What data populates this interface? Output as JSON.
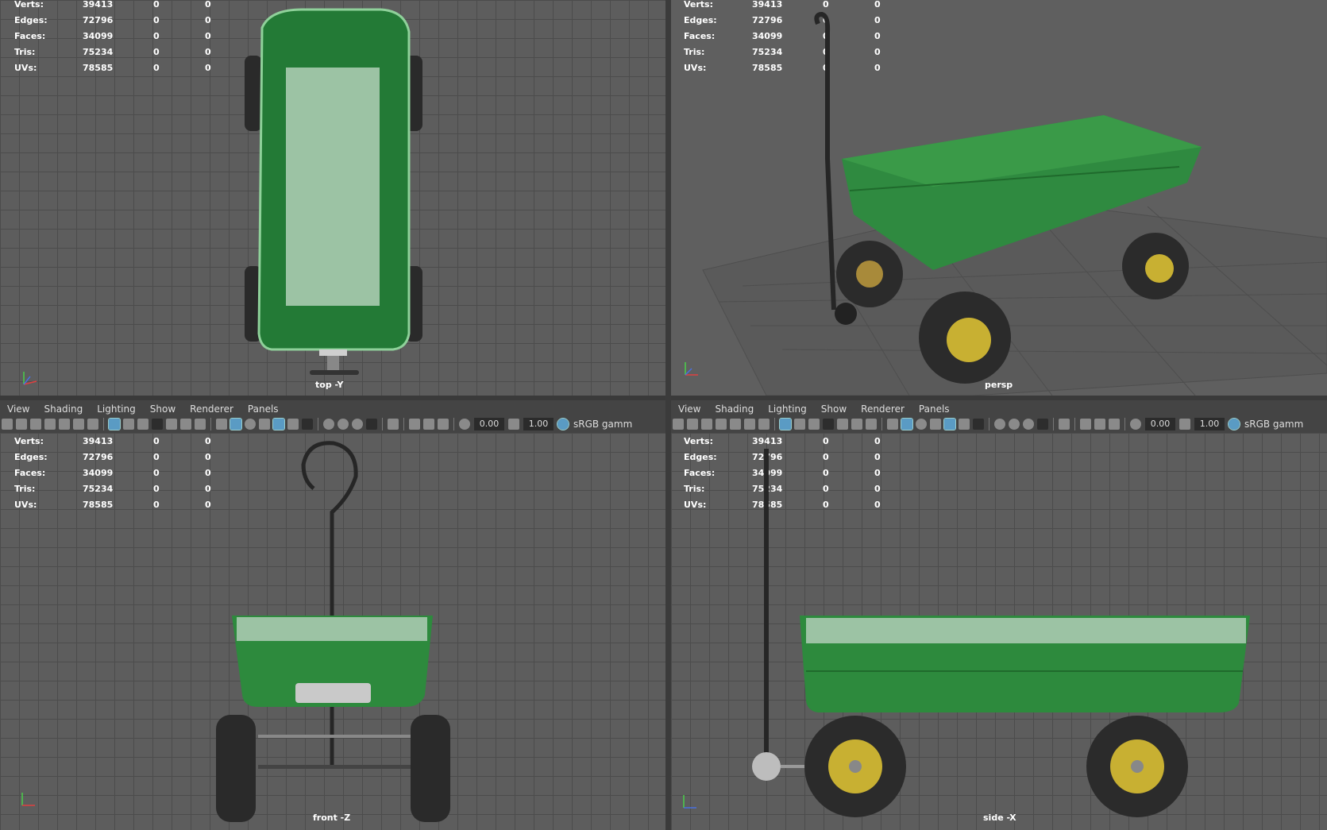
{
  "viewports": {
    "top": {
      "camera": "top -Y"
    },
    "persp": {
      "camera": "persp"
    },
    "front": {
      "camera": "front -Z"
    },
    "side": {
      "camera": "side -X"
    }
  },
  "hud": {
    "rows": [
      {
        "label": "Verts:",
        "total": "39413",
        "selected": "0",
        "selected2": "0"
      },
      {
        "label": "Edges:",
        "total": "72796",
        "selected": "0",
        "selected2": "0"
      },
      {
        "label": "Faces:",
        "total": "34099",
        "selected": "0",
        "selected2": "0"
      },
      {
        "label": "Tris:",
        "total": "75234",
        "selected": "0",
        "selected2": "0"
      },
      {
        "label": "UVs:",
        "total": "78585",
        "selected": "0",
        "selected2": "0"
      }
    ]
  },
  "menu": [
    "View",
    "Shading",
    "Lighting",
    "Show",
    "Renderer",
    "Panels"
  ],
  "toolbar": {
    "exposure": "0.00",
    "gamma": "1.00",
    "color_space": "sRGB gamm"
  },
  "axes": {
    "y": "y",
    "z": "z"
  },
  "colors": {
    "viewport_bg": "#5d5d5d",
    "grid": "#4c4c4c",
    "cart_green": "#2e8a3e",
    "wheel_yellow": "#c8b032"
  }
}
